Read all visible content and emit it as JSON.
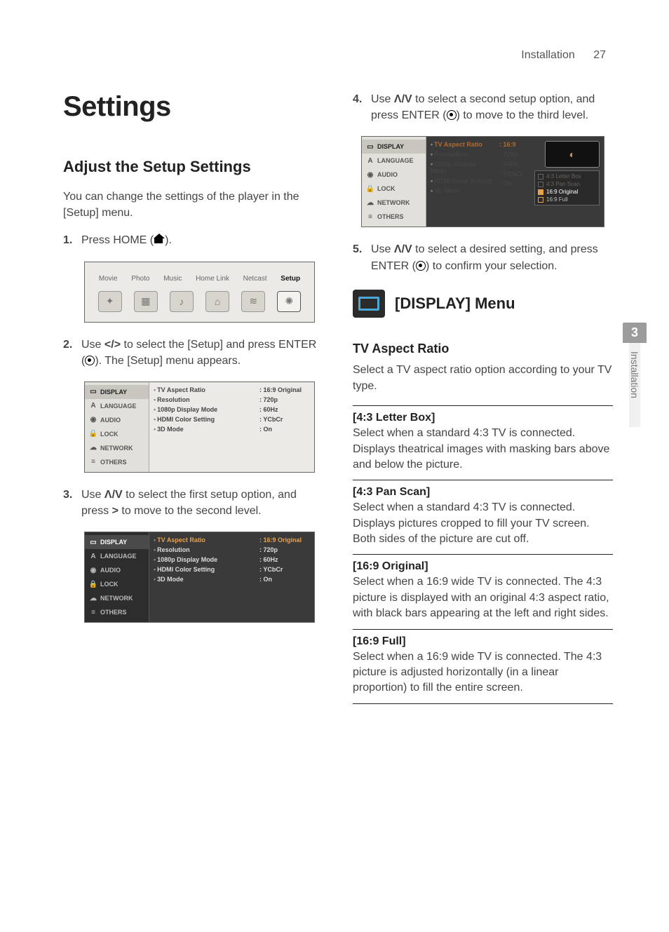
{
  "page": {
    "section": "Installation",
    "number": "27"
  },
  "sideTab": {
    "chapter": "3",
    "label": "Installation"
  },
  "title": "Settings",
  "adjust": {
    "heading": "Adjust the Setup Settings",
    "intro": "You can change the settings of the player in the [Setup] menu.",
    "step1_a": "Press HOME (",
    "step1_b": ").",
    "step2_a": "Use ",
    "step2_nav": "</>",
    "step2_b": " to select the [Setup] and press ENTER (",
    "step2_c": "). The [Setup] menu appears.",
    "step3_a": "Use ",
    "step3_nav": "Λ/V",
    "step3_b": " to select the first setup option, and press ",
    "step3_nav2": ">",
    "step3_c": " to move to the second level.",
    "step4_a": "Use ",
    "step4_nav": "Λ/V",
    "step4_b": " to select a second setup option, and press ENTER (",
    "step4_c": ") to move to the third level.",
    "step5_a": "Use ",
    "step5_nav": "Λ/V",
    "step5_b": " to select a desired setting, and press ENTER (",
    "step5_c": ") to confirm your selection."
  },
  "homeMenu": {
    "items": [
      "Movie",
      "Photo",
      "Music",
      "Home Link",
      "Netcast",
      "Setup"
    ],
    "selectedIndex": 5
  },
  "setupMenu": {
    "side": [
      {
        "label": "DISPLAY"
      },
      {
        "label": "LANGUAGE"
      },
      {
        "label": "AUDIO"
      },
      {
        "label": "LOCK"
      },
      {
        "label": "NETWORK"
      },
      {
        "label": "OTHERS"
      }
    ],
    "options": [
      {
        "label": "TV Aspect Ratio",
        "value": "16:9 Original"
      },
      {
        "label": "Resolution",
        "value": "720p"
      },
      {
        "label": "1080p Display Mode",
        "value": "60Hz"
      },
      {
        "label": "HDMI Color Setting",
        "value": "YCbCr"
      },
      {
        "label": "3D Mode",
        "value": "On"
      }
    ]
  },
  "setup3": {
    "options": [
      {
        "label": "TV Aspect Ratio",
        "value": "16:9"
      },
      {
        "label": "Resolution",
        "value": "720p"
      },
      {
        "label": "1080p Display Mode",
        "value": "60Hz"
      },
      {
        "label": "HDMI Color Setting",
        "value": "YCbCr"
      },
      {
        "label": "3D Mode",
        "value": "On"
      }
    ],
    "aspectChoices": [
      "4:3 Letter Box",
      "4:3 Pan Scan",
      "16:9 Original",
      "16:9 Full"
    ]
  },
  "displayMenu": {
    "heading": "[DISPLAY] Menu",
    "tvAspect": {
      "title": "TV Aspect Ratio",
      "desc": "Select a TV aspect ratio option according to your TV type."
    },
    "opts": [
      {
        "title": "[4:3 Letter Box]",
        "desc": "Select when a standard 4:3 TV is connected. Displays theatrical images with masking bars above and below the picture."
      },
      {
        "title": "[4:3 Pan Scan]",
        "desc": "Select when a standard 4:3 TV is connected. Displays pictures cropped to fill your TV screen. Both sides of the picture are cut off."
      },
      {
        "title": "[16:9 Original]",
        "desc": "Select when a 16:9 wide TV is connected. The 4:3 picture is displayed with an original 4:3 aspect ratio, with black bars appearing at the left and right sides."
      },
      {
        "title": "[16:9 Full]",
        "desc": "Select when a 16:9 wide TV is connected. The 4:3 picture is adjusted horizontally (in a linear proportion) to fill the entire screen."
      }
    ]
  }
}
